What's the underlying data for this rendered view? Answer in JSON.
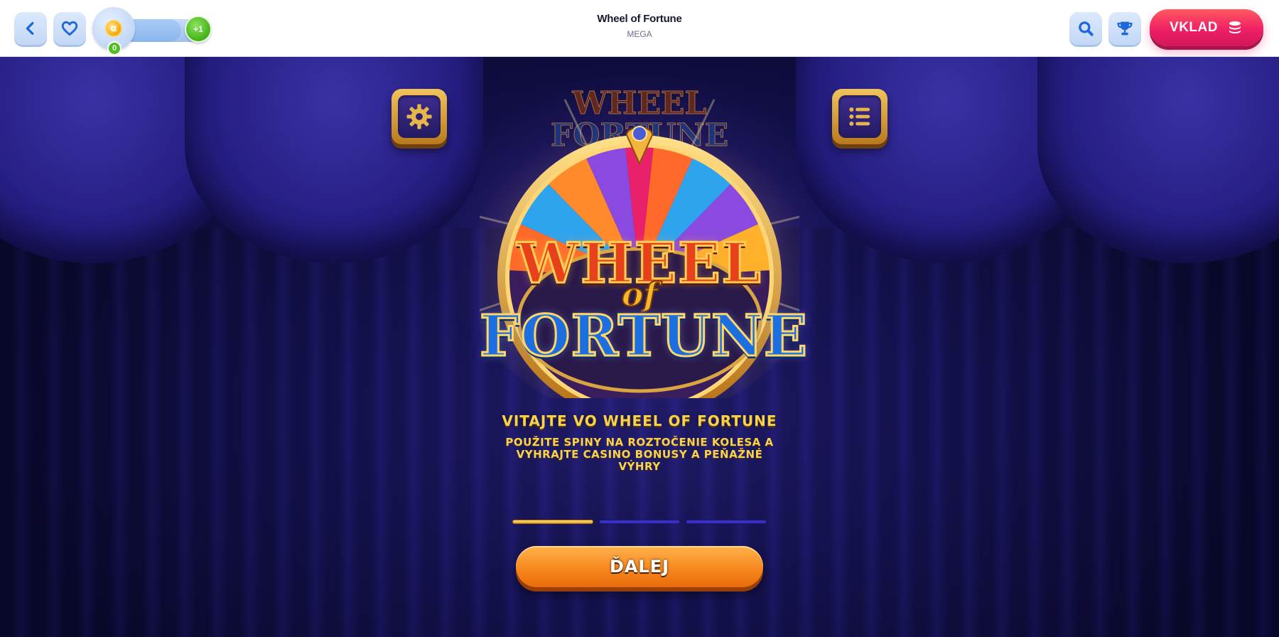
{
  "header": {
    "title": "Wheel of Fortune",
    "subtitle": "MEGA",
    "level": {
      "count": "0",
      "plus": "+1",
      "coin_glyph": "α",
      "progress": 0.7
    },
    "deposit_label": "VKLAD",
    "icons": [
      "chevron-left-icon",
      "heart-icon",
      "coin-icon",
      "search-icon",
      "trophy-icon",
      "coins-icon"
    ]
  },
  "game": {
    "logo": {
      "line1": "WHEEL",
      "line2": "of",
      "line3": "FORTUNE"
    },
    "welcome_title": "VITAJTE VO WHEEL OF FORTUNE",
    "welcome_text": "POUŽITE SPINY NA ROZTOČENIE KOLESA A VYHRAJTE CASINO BONUSY A PEŇAŽNÉ VÝHRY",
    "steps": {
      "total": 3,
      "current": 1
    },
    "next_label": "ĎALEJ",
    "icons": [
      "gear-icon",
      "list-icon"
    ]
  },
  "colors": {
    "accent_blue": "#1f6fe0",
    "deposit_red": "#ef1f64",
    "gold_text": "#f9d24b",
    "next_orange": "#f7891e",
    "step_active": "#f2bf3c",
    "step_inactive": "#3a2fc4"
  }
}
